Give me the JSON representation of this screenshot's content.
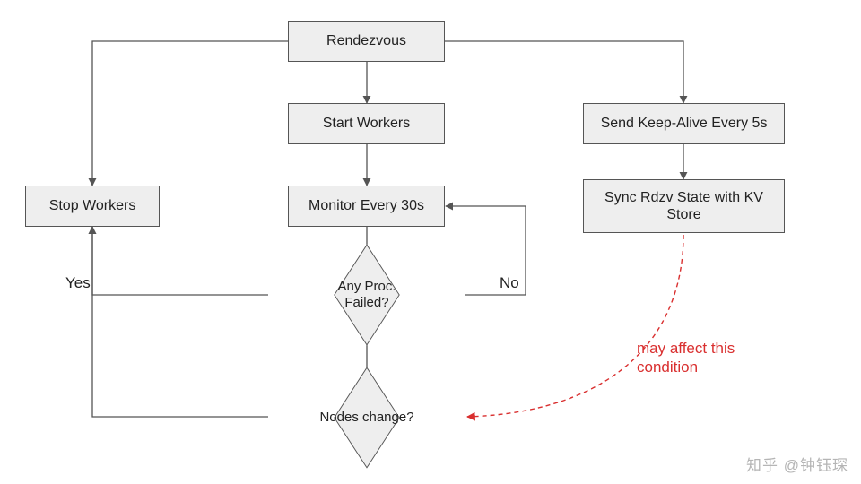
{
  "nodes": {
    "rendezvous": "Rendezvous",
    "start_workers": "Start Workers",
    "monitor": "Monitor Every 30s",
    "stop_workers": "Stop Workers",
    "keepalive": "Send Keep-Alive Every 5s",
    "sync_rdzv": "Sync Rdzv State with KV Store"
  },
  "decisions": {
    "proc_failed": "Any Proc.\nFailed?",
    "nodes_change": "Nodes change?"
  },
  "edge_labels": {
    "yes": "Yes",
    "no": "No"
  },
  "annotation": "may affect this\ncondition",
  "watermark": "知乎 @钟钰琛"
}
